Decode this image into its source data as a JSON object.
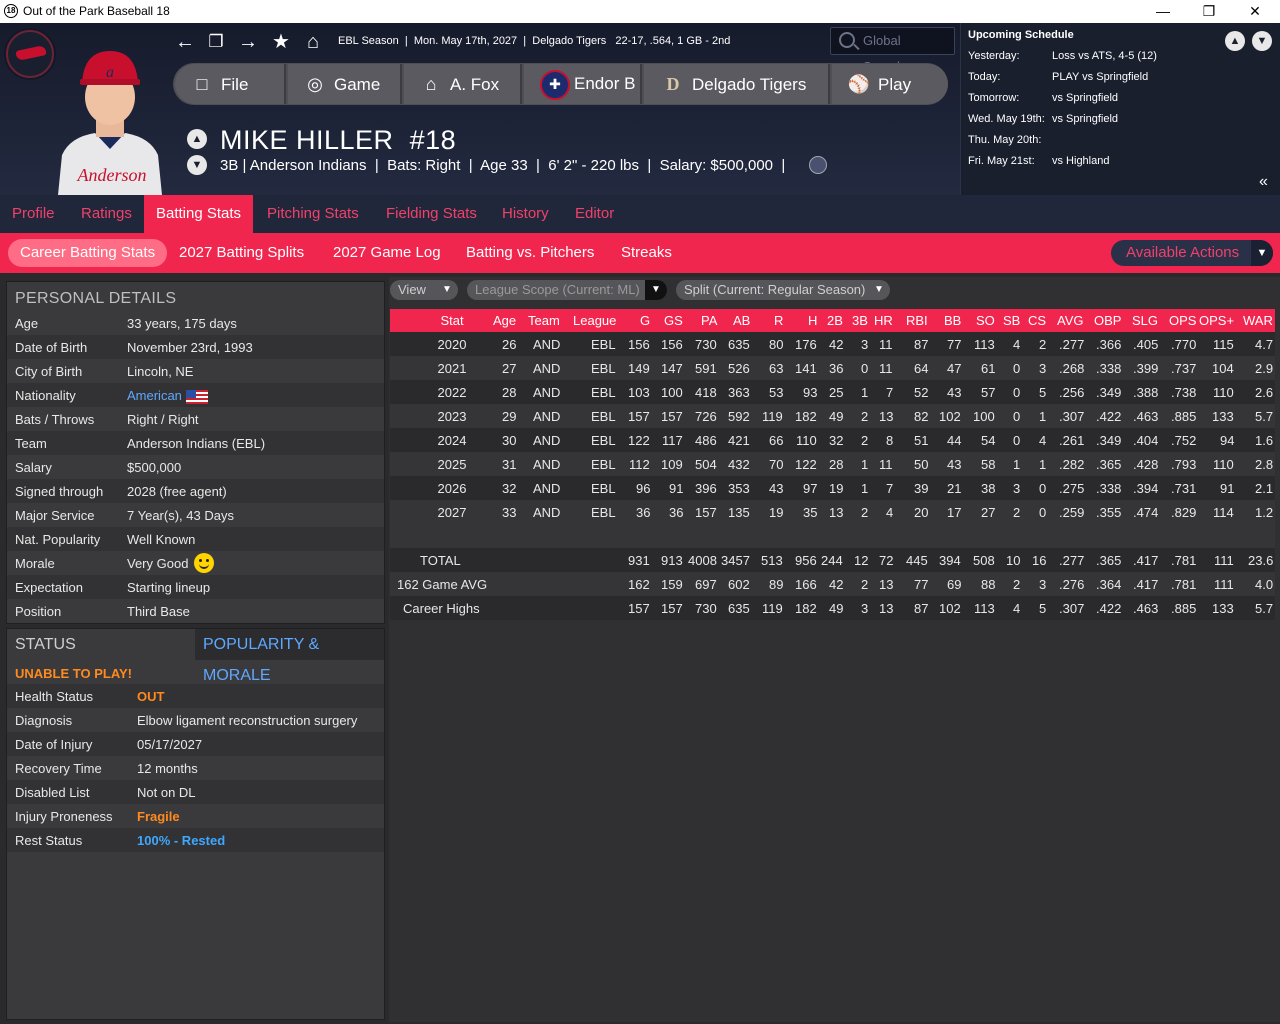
{
  "window": {
    "title": "Out of the Park Baseball 18",
    "app_badge": "18"
  },
  "nav": {
    "league_info": "EBL Season  |  Mon. May 17th, 2027  |  Delgado Tigers   22-17, .564, 1 GB - 2nd",
    "search_placeholder": "Global Search..."
  },
  "main_buttons": [
    {
      "label": "File",
      "icon": "document-icon"
    },
    {
      "label": "Game",
      "icon": "globe-icon"
    },
    {
      "label": "A. Fox",
      "icon": "home-icon"
    },
    {
      "label": "Endor B",
      "icon": "team-logo-icon"
    },
    {
      "label": "Delgado Tigers",
      "icon": "tigers-logo-icon"
    },
    {
      "label": "Play",
      "icon": "baseball-icon"
    }
  ],
  "player": {
    "name": "MIKE HILLER",
    "number": "#18",
    "subtitle": "3B | Anderson Indians  |  Bats: Right  |  Age 33  |  6' 2\" - 220 lbs  |  Salary: $500,000  |",
    "jersey_text": "Anderson"
  },
  "schedule": {
    "title": "Upcoming Schedule",
    "rows": [
      {
        "day": "Yesterday:",
        "value": "Loss vs ATS, 4-5 (12)"
      },
      {
        "day": "Today:",
        "value": "PLAY vs Springfield"
      },
      {
        "day": "Tomorrow:",
        "value": "vs Springfield"
      },
      {
        "day": "Wed. May 19th:",
        "value": "vs Springfield"
      },
      {
        "day": "Thu. May 20th:",
        "value": ""
      },
      {
        "day": "Fri. May 21st:",
        "value": "vs Highland"
      }
    ]
  },
  "tabs": [
    "Profile",
    "Ratings",
    "Batting Stats",
    "Pitching Stats",
    "Fielding Stats",
    "History",
    "Editor"
  ],
  "active_tab": "Batting Stats",
  "subtabs": [
    "Career Batting Stats",
    "2027 Batting Splits",
    "2027 Game Log",
    "Batting vs. Pitchers",
    "Streaks"
  ],
  "active_subtab": "Career Batting Stats",
  "actions_label": "Available Actions",
  "personal": {
    "title": "PERSONAL DETAILS",
    "rows": [
      {
        "k": "Age",
        "v": "33 years, 175 days"
      },
      {
        "k": "Date of Birth",
        "v": "November 23rd, 1993"
      },
      {
        "k": "City of Birth",
        "v": "Lincoln, NE"
      },
      {
        "k": "Nationality",
        "v": "American"
      },
      {
        "k": "Bats / Throws",
        "v": "Right / Right"
      },
      {
        "k": "Team",
        "v": "Anderson Indians (EBL)"
      },
      {
        "k": "Salary",
        "v": "$500,000"
      },
      {
        "k": "Signed through",
        "v": "2028 (free agent)"
      },
      {
        "k": "Major Service",
        "v": "7 Year(s), 43 Days"
      },
      {
        "k": "Nat. Popularity",
        "v": "Well Known"
      },
      {
        "k": "Morale",
        "v": "Very Good"
      },
      {
        "k": "Expectation",
        "v": "Starting lineup"
      },
      {
        "k": "Position",
        "v": "Third Base"
      }
    ]
  },
  "status": {
    "tab_status": "STATUS",
    "tab_popularity": "POPULARITY & MORALE",
    "alert": "UNABLE TO PLAY!",
    "rows": [
      {
        "k": "Health Status",
        "v": "OUT"
      },
      {
        "k": "Diagnosis",
        "v": "Elbow ligament reconstruction surgery"
      },
      {
        "k": "Date of Injury",
        "v": "05/17/2027"
      },
      {
        "k": "Recovery Time",
        "v": "12 months"
      },
      {
        "k": "Disabled List",
        "v": "Not on DL"
      },
      {
        "k": "Injury Proneness",
        "v": "Fragile"
      },
      {
        "k": "Rest Status",
        "v": "100% - Rested"
      }
    ]
  },
  "filters": {
    "view": "View",
    "scope": "League Scope  (Current: ML)",
    "split": "Split  (Current: Regular Season)"
  },
  "stats": {
    "columns": [
      "Stat",
      "Age",
      "Team",
      "League",
      "G",
      "GS",
      "PA",
      "AB",
      "R",
      "H",
      "2B",
      "3B",
      "HR",
      "RBI",
      "BB",
      "SO",
      "SB",
      "CS",
      "AVG",
      "OBP",
      "SLG",
      "OPS",
      "OPS+",
      "WAR"
    ],
    "rows": [
      [
        "2020",
        "26",
        "AND",
        "EBL",
        "156",
        "156",
        "730",
        "635",
        "80",
        "176",
        "42",
        "3",
        "11",
        "87",
        "77",
        "113",
        "4",
        "2",
        ".277",
        ".366",
        ".405",
        ".770",
        "115",
        "4.7"
      ],
      [
        "2021",
        "27",
        "AND",
        "EBL",
        "149",
        "147",
        "591",
        "526",
        "63",
        "141",
        "36",
        "0",
        "11",
        "64",
        "47",
        "61",
        "0",
        "3",
        ".268",
        ".338",
        ".399",
        ".737",
        "104",
        "2.9"
      ],
      [
        "2022",
        "28",
        "AND",
        "EBL",
        "103",
        "100",
        "418",
        "363",
        "53",
        "93",
        "25",
        "1",
        "7",
        "52",
        "43",
        "57",
        "0",
        "5",
        ".256",
        ".349",
        ".388",
        ".738",
        "110",
        "2.6"
      ],
      [
        "2023",
        "29",
        "AND",
        "EBL",
        "157",
        "157",
        "726",
        "592",
        "119",
        "182",
        "49",
        "2",
        "13",
        "82",
        "102",
        "100",
        "0",
        "1",
        ".307",
        ".422",
        ".463",
        ".885",
        "133",
        "5.7"
      ],
      [
        "2024",
        "30",
        "AND",
        "EBL",
        "122",
        "117",
        "486",
        "421",
        "66",
        "110",
        "32",
        "2",
        "8",
        "51",
        "44",
        "54",
        "0",
        "4",
        ".261",
        ".349",
        ".404",
        ".752",
        "94",
        "1.6"
      ],
      [
        "2025",
        "31",
        "AND",
        "EBL",
        "112",
        "109",
        "504",
        "432",
        "70",
        "122",
        "28",
        "1",
        "11",
        "50",
        "43",
        "58",
        "1",
        "1",
        ".282",
        ".365",
        ".428",
        ".793",
        "110",
        "2.8"
      ],
      [
        "2026",
        "32",
        "AND",
        "EBL",
        "96",
        "91",
        "396",
        "353",
        "43",
        "97",
        "19",
        "1",
        "7",
        "39",
        "21",
        "38",
        "3",
        "0",
        ".275",
        ".338",
        ".394",
        ".731",
        "91",
        "2.1"
      ],
      [
        "2027",
        "33",
        "AND",
        "EBL",
        "36",
        "36",
        "157",
        "135",
        "19",
        "35",
        "13",
        "2",
        "4",
        "20",
        "17",
        "27",
        "2",
        "0",
        ".259",
        ".355",
        ".474",
        ".829",
        "114",
        "1.2"
      ]
    ],
    "totals": [
      [
        "TOTAL",
        "",
        "",
        "",
        "931",
        "913",
        "4008",
        "3457",
        "513",
        "956",
        "244",
        "12",
        "72",
        "445",
        "394",
        "508",
        "10",
        "16",
        ".277",
        ".365",
        ".417",
        ".781",
        "111",
        "23.6"
      ],
      [
        "162 Game AVG",
        "",
        "",
        "",
        "162",
        "159",
        "697",
        "602",
        "89",
        "166",
        "42",
        "2",
        "13",
        "77",
        "69",
        "88",
        "2",
        "3",
        ".276",
        ".364",
        ".417",
        ".781",
        "111",
        "4.0"
      ],
      [
        "Career Highs",
        "",
        "",
        "",
        "157",
        "157",
        "730",
        "635",
        "119",
        "182",
        "49",
        "3",
        "13",
        "87",
        "102",
        "113",
        "4",
        "5",
        ".307",
        ".422",
        ".463",
        ".885",
        "133",
        "5.7"
      ]
    ]
  },
  "colors": {
    "accent": "#f0264f",
    "link": "#5fa8ff",
    "warn": "#ff8a1f",
    "info": "#3ea8ff"
  }
}
